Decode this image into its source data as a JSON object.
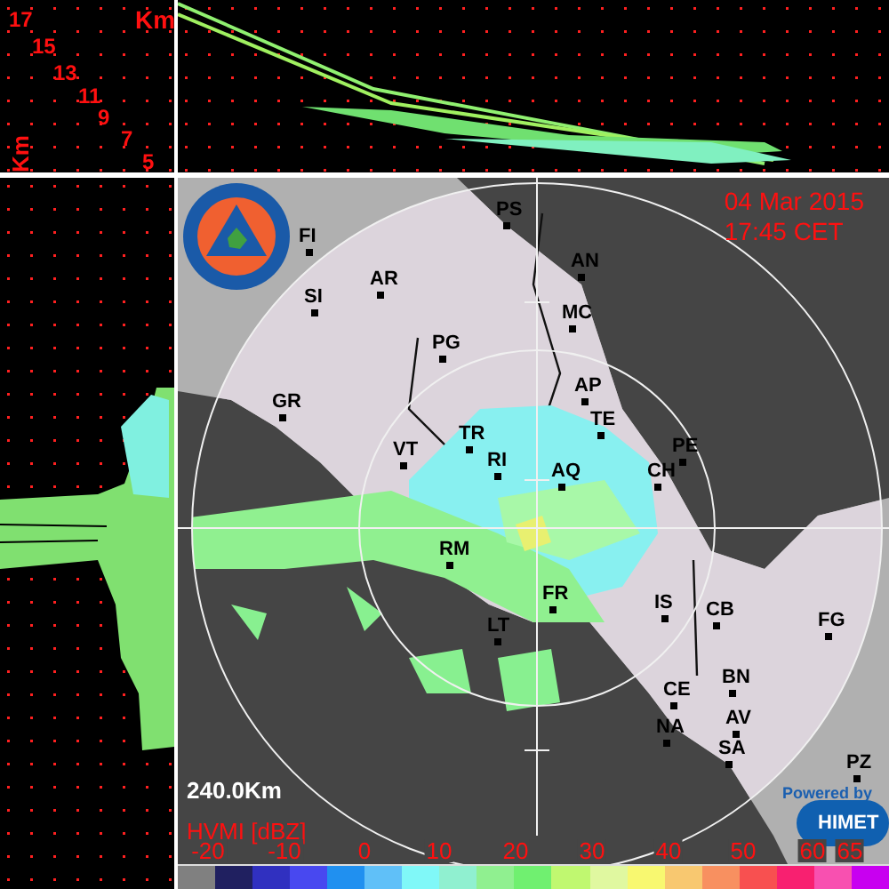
{
  "height_panel": {
    "unit_top": "Km",
    "unit_side": "Km",
    "heights": [
      "17",
      "15",
      "13",
      "11",
      "9",
      "7",
      "5"
    ]
  },
  "map": {
    "date": "04 Mar 2015",
    "time": "17:45 CET",
    "range": "240.0Km",
    "cities": [
      {
        "label": "FI"
      },
      {
        "label": "PS"
      },
      {
        "label": "AN"
      },
      {
        "label": "AR"
      },
      {
        "label": "SI"
      },
      {
        "label": "MC"
      },
      {
        "label": "PG"
      },
      {
        "label": "GR"
      },
      {
        "label": "AP"
      },
      {
        "label": "TE"
      },
      {
        "label": "TR"
      },
      {
        "label": "VT"
      },
      {
        "label": "PE"
      },
      {
        "label": "CH"
      },
      {
        "label": "RI"
      },
      {
        "label": "AQ"
      },
      {
        "label": "RM"
      },
      {
        "label": "FR"
      },
      {
        "label": "LT"
      },
      {
        "label": "IS"
      },
      {
        "label": "CB"
      },
      {
        "label": "FG"
      },
      {
        "label": "CE"
      },
      {
        "label": "BN"
      },
      {
        "label": "AV"
      },
      {
        "label": "NA"
      },
      {
        "label": "SA"
      },
      {
        "label": "PZ"
      }
    ],
    "credit": {
      "powered": "Powered by",
      "brand": "HIMET"
    }
  },
  "legend": {
    "title": "HVMI [dBZ]",
    "ticks": [
      "-20",
      "-10",
      "0",
      "10",
      "20",
      "30",
      "40",
      "50",
      "60",
      "65"
    ],
    "swatches": [
      {
        "color": "#808080"
      },
      {
        "color": "#202060"
      },
      {
        "color": "#3030c0"
      },
      {
        "color": "#4848f0"
      },
      {
        "color": "#2090f0"
      },
      {
        "color": "#60c0f8"
      },
      {
        "color": "#80f8f8"
      },
      {
        "color": "#90f0d0"
      },
      {
        "color": "#90f090"
      },
      {
        "color": "#70f070"
      },
      {
        "color": "#c0f870"
      },
      {
        "color": "#e0f8a0"
      },
      {
        "color": "#f8f870"
      },
      {
        "color": "#f8c870"
      },
      {
        "color": "#f89060"
      },
      {
        "color": "#f85050"
      },
      {
        "color": "#f82070"
      },
      {
        "color": "#f850b0"
      },
      {
        "color": "#c800f0"
      }
    ]
  }
}
